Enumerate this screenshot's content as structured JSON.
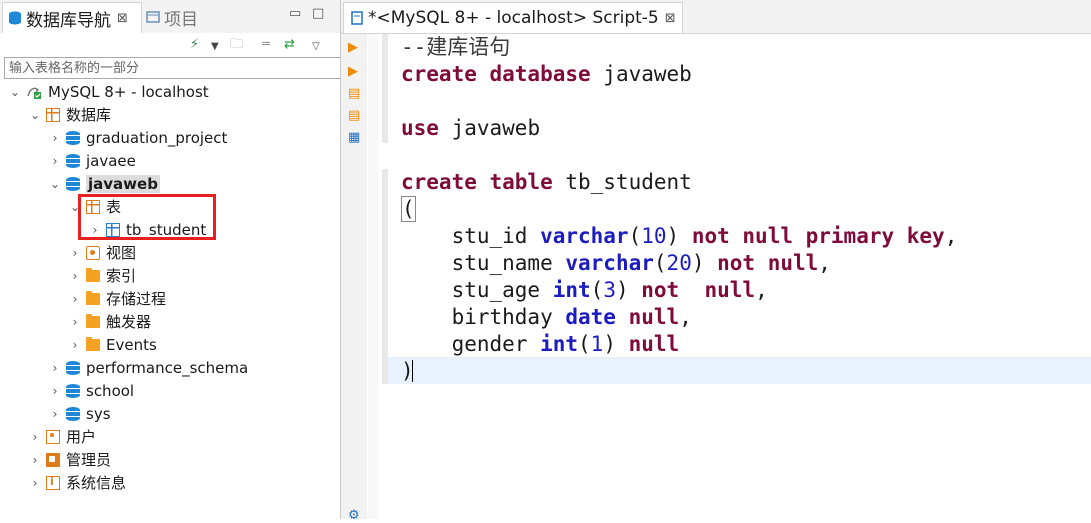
{
  "navigator": {
    "tab_title": "数据库导航",
    "tab_close": "⊠",
    "inactive_tab": "项目",
    "filter_placeholder": "输入表格名称的一部分",
    "connection": "MySQL 8+ - localhost",
    "databases_folder": "数据库",
    "databases": [
      "graduation_project",
      "javaee",
      "javaweb",
      "performance_schema",
      "school",
      "sys"
    ],
    "expanded_db": "javaweb",
    "tables_folder": "表",
    "table": "tb_student",
    "db_children": [
      "视图",
      "索引",
      "存储过程",
      "触发器",
      "Events"
    ],
    "root_children": [
      "用户",
      "管理员",
      "系统信息"
    ]
  },
  "editor": {
    "tab_title": "*<MySQL 8+ - localhost> Script-5",
    "tab_close": "⊠",
    "code_lines": [
      "--建库语句",
      "create database javaweb",
      "",
      "use javaweb",
      "",
      "create table tb_student",
      "(",
      "    stu_id varchar(10) not null primary key,",
      "    stu_name varchar(20) not null,",
      "    stu_age int(3) not  null,",
      "    birthday date null,",
      "    gender int(1) null",
      ")"
    ]
  },
  "colors": {
    "highlight_box": "#e8201f",
    "keyword": "#7f0b3a",
    "type": "#1c1cc0",
    "db_icon": "#1e88d6",
    "folder_icon": "#f5a223"
  }
}
